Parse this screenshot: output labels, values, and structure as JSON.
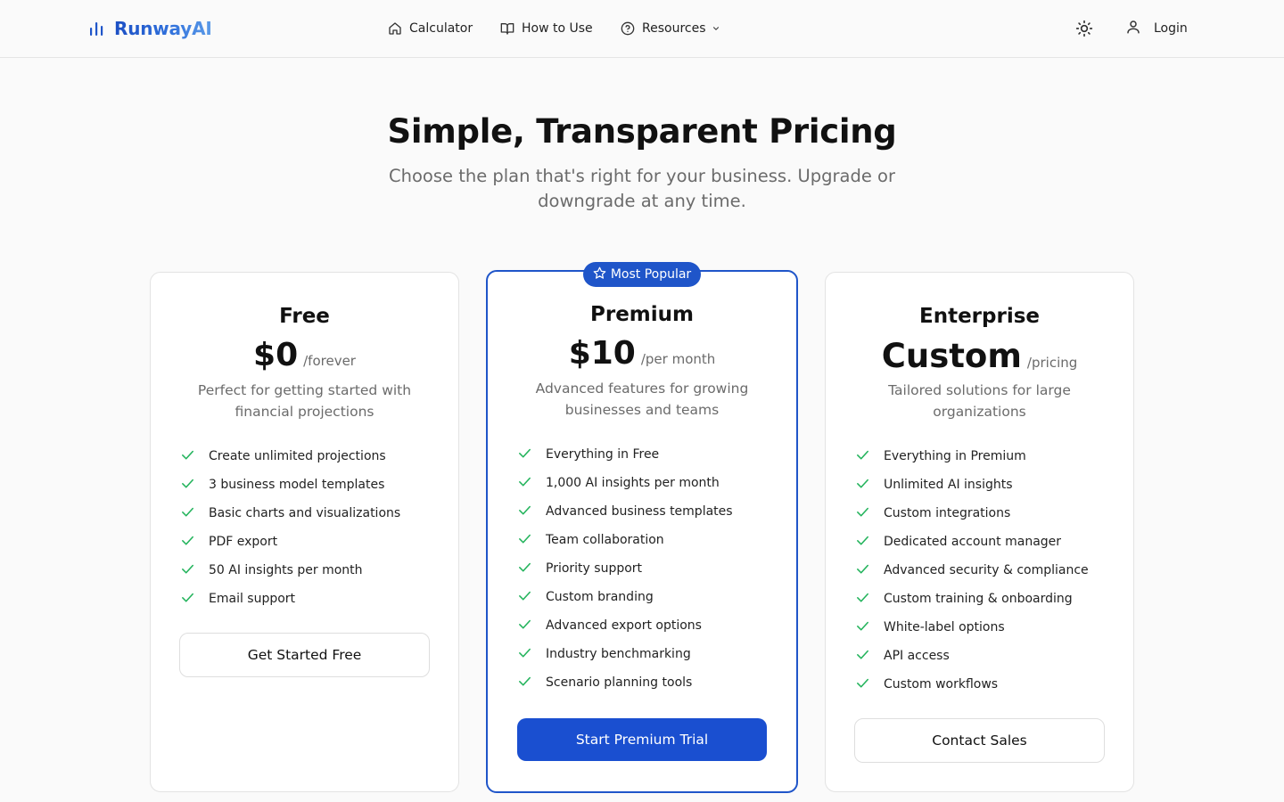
{
  "header": {
    "brand": "RunwayAI",
    "nav": [
      {
        "label": "Calculator",
        "icon": "home-icon"
      },
      {
        "label": "How to Use",
        "icon": "book-icon"
      },
      {
        "label": "Resources",
        "icon": "help-circle-icon"
      }
    ],
    "theme_icon": "sun-icon",
    "login_label": "Login"
  },
  "hero": {
    "title": "Simple, Transparent Pricing",
    "subtitle": "Choose the plan that's right for your business. Upgrade or downgrade at any time."
  },
  "plans": [
    {
      "name": "Free",
      "price": "$0",
      "period": "/forever",
      "description": "Perfect for getting started with financial projections",
      "features": [
        "Create unlimited projections",
        "3 business model templates",
        "Basic charts and visualizations",
        "PDF export",
        "50 AI insights per month",
        "Email support"
      ],
      "cta": "Get Started Free"
    },
    {
      "name": "Premium",
      "badge": "Most Popular",
      "price": "$10",
      "period": "/per month",
      "description": "Advanced features for growing businesses and teams",
      "features": [
        "Everything in Free",
        "1,000 AI insights per month",
        "Advanced business templates",
        "Team collaboration",
        "Priority support",
        "Custom branding",
        "Advanced export options",
        "Industry benchmarking",
        "Scenario planning tools"
      ],
      "cta": "Start Premium Trial"
    },
    {
      "name": "Enterprise",
      "price": "Custom",
      "period": "/pricing",
      "description": "Tailored solutions for large organizations",
      "features": [
        "Everything in Premium",
        "Unlimited AI insights",
        "Custom integrations",
        "Dedicated account manager",
        "Advanced security & compliance",
        "Custom training & onboarding",
        "White-label options",
        "API access",
        "Custom workflows"
      ],
      "cta": "Contact Sales"
    }
  ],
  "colors": {
    "accent": "#1f55c9",
    "check": "#22b35b",
    "muted_text": "#6b6b6b"
  }
}
